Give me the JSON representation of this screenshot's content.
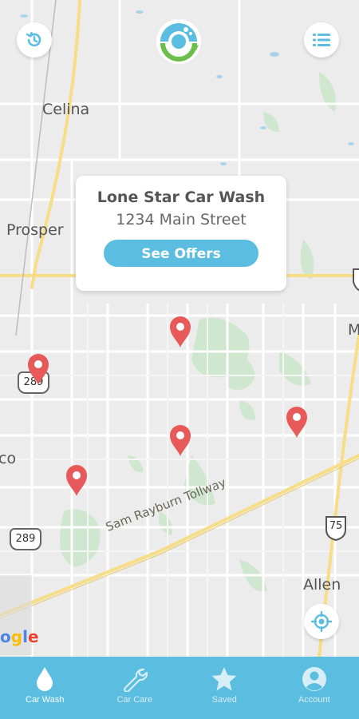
{
  "map": {
    "labels": {
      "celina": "Celina",
      "prosper": "Prosper",
      "allen": "Allen",
      "frisco_partial": "co",
      "m_partial": "M"
    },
    "shields": {
      "state_289_a": "289",
      "state_289_b": "289",
      "us_75": "75"
    },
    "tollway_label": "Sam Rayburn Tollway",
    "google_logo": "ogle"
  },
  "popup": {
    "name": "Lone Star Car Wash",
    "address": "1234 Main Street",
    "button_label": "See Offers"
  },
  "colors": {
    "accent": "#5bbde0",
    "pin": "#e85a5a",
    "nav_bg": "#5bbde0"
  },
  "bottom_nav": {
    "items": [
      {
        "label": "Car Wash",
        "icon": "water-drop-icon",
        "active": true
      },
      {
        "label": "Car Care",
        "icon": "wrench-icon",
        "active": false
      },
      {
        "label": "Saved",
        "icon": "star-icon",
        "active": false
      },
      {
        "label": "Account",
        "icon": "account-icon",
        "active": false
      }
    ]
  }
}
